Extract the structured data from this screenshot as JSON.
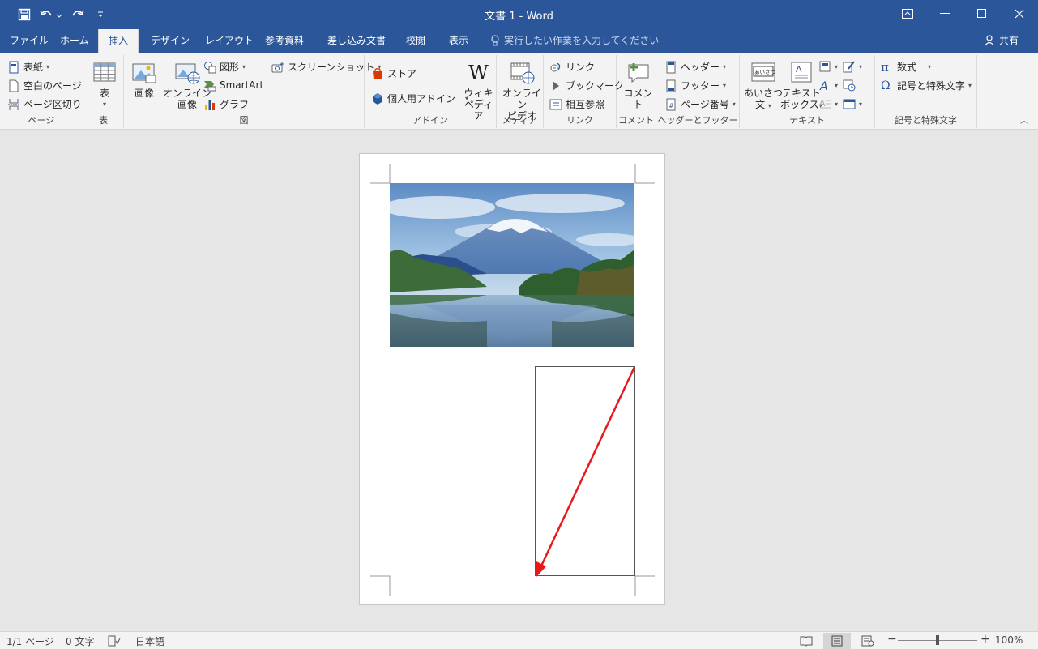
{
  "titlebar": {
    "title": "文書 1  -  Word"
  },
  "tabs": [
    {
      "label": "ファイル"
    },
    {
      "label": "ホーム"
    },
    {
      "label": "挿入"
    },
    {
      "label": "デザイン"
    },
    {
      "label": "レイアウト"
    },
    {
      "label": "参考資料"
    },
    {
      "label": "差し込み文書"
    },
    {
      "label": "校閲"
    },
    {
      "label": "表示"
    }
  ],
  "tellme": "実行したい作業を入力してください",
  "share": "共有",
  "ribbon": {
    "page": {
      "cover": "表紙",
      "blank": "空白のページ",
      "break": "ページ区切り",
      "label": "ページ"
    },
    "table": {
      "table": "表",
      "label": "表"
    },
    "illustrations": {
      "picture": "画像",
      "online1": "オンライン",
      "online2": "画像",
      "shapes": "図形",
      "smartart": "SmartArt",
      "chart": "グラフ",
      "screenshot": "スクリーンショット",
      "label": "図"
    },
    "addins": {
      "store": "ストア",
      "myaddins": "個人用アドイン",
      "wiki1": "ウィキ",
      "wiki2": "ペディア",
      "label": "アドイン"
    },
    "media": {
      "video1": "オンライン",
      "video2": "ビデオ",
      "label": "メディア"
    },
    "links": {
      "link": "リンク",
      "bookmark": "ブックマーク",
      "crossref": "相互参照",
      "label": "リンク"
    },
    "comments": {
      "comment": "コメント",
      "label": "コメント"
    },
    "headerfooter": {
      "header": "ヘッダー",
      "footer": "フッター",
      "pagenum": "ページ番号",
      "label": "ヘッダーとフッター"
    },
    "text": {
      "greeting1": "あいさつ",
      "greeting2": "文",
      "textbox1": "テキスト",
      "textbox2": "ボックス",
      "label": "テキスト",
      "greeting_icon_text": "あいさつ"
    },
    "symbols": {
      "equation": "数式",
      "symbol": "記号と特殊文字",
      "label": "記号と特殊文字"
    }
  },
  "status": {
    "page": "1/1 ページ",
    "words": "0 文字",
    "lang": "日本語",
    "zoom": "100%",
    "zoom_level": 1.0
  },
  "colors": {
    "brand": "#2b579a",
    "arrow": "#e8191a"
  }
}
